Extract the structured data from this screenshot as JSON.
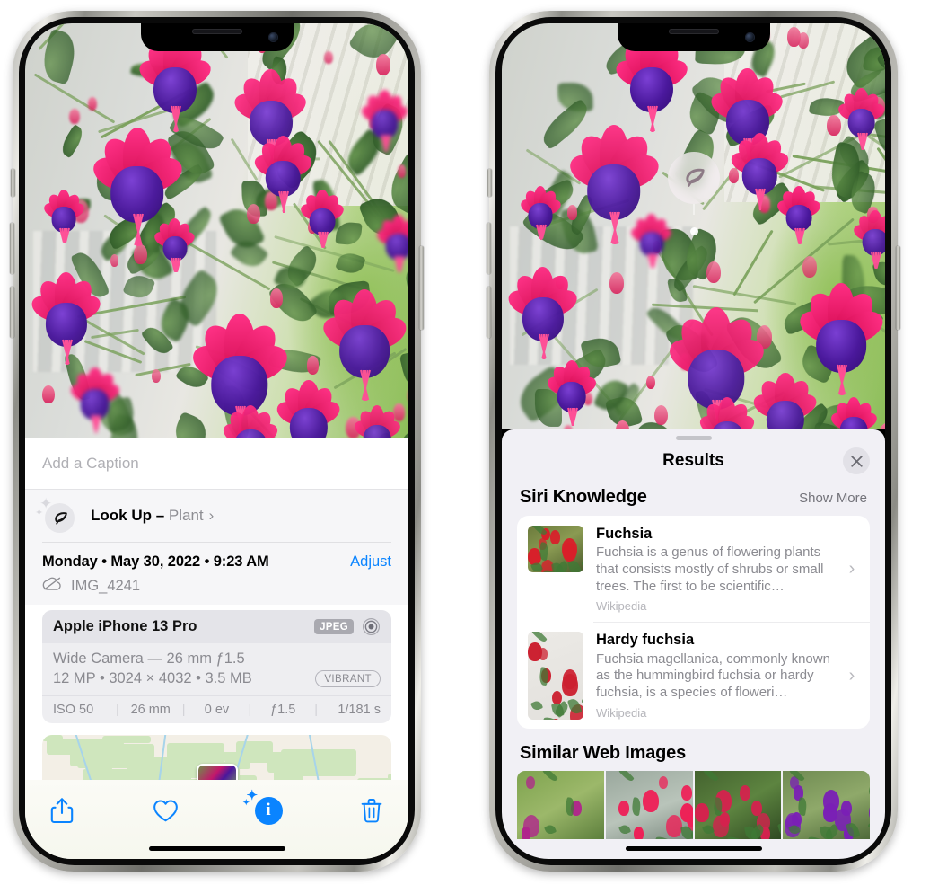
{
  "left_phone": {
    "caption": {
      "placeholder": "Add a Caption",
      "value": ""
    },
    "lookup": {
      "label": "Look Up –",
      "subject": "Plant",
      "chevron": "›",
      "icon": "leaf-icon"
    },
    "date": {
      "text": "Monday • May 30, 2022 • 9:23 AM",
      "adjust_label": "Adjust"
    },
    "file": {
      "name": "IMG_4241",
      "icon": "cloud-slash-icon"
    },
    "metadata": {
      "device": "Apple iPhone 13 Pro",
      "format_badge": "JPEG",
      "lens_icon": "aperture-icon",
      "lens_line": "Wide Camera — 26 mm ƒ1.5",
      "size_line": "12 MP • 3024 × 4032 • 3.5 MB",
      "quality_badge": "VIBRANT",
      "exif": [
        "ISO 50",
        "26 mm",
        "0 ev",
        "ƒ1.5",
        "1/181 s"
      ],
      "exif_sep": "|"
    },
    "toolbar": {
      "share": "share-icon",
      "favorite": "heart-icon",
      "info": "info-sparkle-icon",
      "info_glyph": "i",
      "delete": "trash-icon"
    }
  },
  "right_phone": {
    "badge": {
      "icon": "leaf-icon"
    },
    "sheet": {
      "title": "Results",
      "close_glyph": "✕"
    },
    "siri_knowledge": {
      "heading": "Siri Knowledge",
      "show_more": "Show More",
      "items": [
        {
          "title": "Fuchsia",
          "description": "Fuchsia is a genus of flowering plants that consists mostly of shrubs or small trees. The first to be scientific…",
          "source": "Wikipedia",
          "chevron": "›"
        },
        {
          "title": "Hardy fuchsia",
          "description": "Fuchsia magellanica, commonly known as the hummingbird fuchsia or hardy fuchsia, is a species of floweri…",
          "source": "Wikipedia",
          "chevron": "›"
        }
      ]
    },
    "similar_web_images": {
      "heading": "Similar Web Images",
      "count": 4
    }
  },
  "colors": {
    "accent_blue": "#0a84ff",
    "sheet_bg": "#f1f0f5",
    "secondary_text": "#8e8e93",
    "card_white": "#ffffff",
    "flower_pink": "#e0145f",
    "flower_purple": "#4a189c"
  }
}
